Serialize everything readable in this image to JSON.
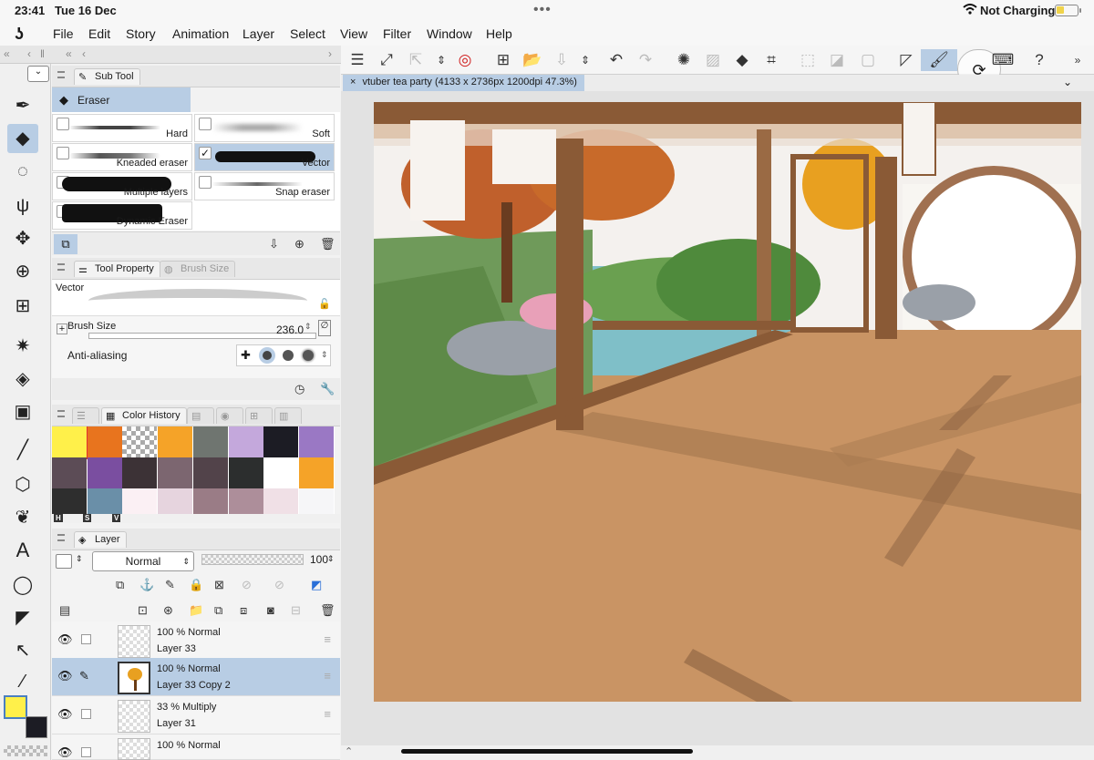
{
  "status": {
    "time": "23:41",
    "date": "Tue 16 Dec",
    "charging": "Not Charging"
  },
  "menu": [
    "File",
    "Edit",
    "Story",
    "Animation",
    "Layer",
    "Select",
    "View",
    "Filter",
    "Window",
    "Help"
  ],
  "subtool": {
    "tab": "Sub Tool",
    "group": "Eraser",
    "brushes": [
      {
        "label": "Hard"
      },
      {
        "label": "Soft"
      },
      {
        "label": "Kneaded eraser"
      },
      {
        "label": "Vector"
      },
      {
        "label": "Multiple layers"
      },
      {
        "label": "Snap eraser"
      },
      {
        "label": "Dynamic Eraser"
      }
    ]
  },
  "tool_property": {
    "tab": "Tool Property",
    "tab2": "Brush Size",
    "preset": "Vector",
    "brush_size_label": "Brush Size",
    "brush_size_value": "236.0",
    "anti_alias_label": "Anti-aliasing"
  },
  "color_history": {
    "tab": "Color History",
    "hsv": [
      "H",
      "S",
      "V"
    ],
    "colors": [
      "#fff04a",
      "#e8741e",
      "checker",
      "#f5a328",
      "#6f7570",
      "#c4a8dc",
      "#1c1c24",
      "#9a78c4",
      "#5c4c56",
      "#7a4ea0",
      "#3c3236",
      "#7c6670",
      "#52434a",
      "#2c2e2e",
      "#ffffff",
      "#f5a328",
      "#2e2e2e",
      "#6a8fa8",
      "#fbf0f4",
      "#e6d4de",
      "#9a7c86",
      "#ad8e9a",
      "#f0e0e6",
      "#f6f6f8"
    ]
  },
  "layer": {
    "tab": "Layer",
    "blend_mode": "Normal",
    "opacity": "100",
    "rows": [
      {
        "mode": "100 %  Normal",
        "name": "Layer 33"
      },
      {
        "mode": "100 %  Normal",
        "name": "Layer 33 Copy 2"
      },
      {
        "mode": "33 %  Multiply",
        "name": "Layer 31"
      },
      {
        "mode": "100 %  Normal",
        "name": ""
      }
    ]
  },
  "canvas": {
    "doc_title": "vtuber tea party (4133 x 2736px 1200dpi 47.3%)"
  },
  "colors": {
    "accent": "#b8cde4",
    "main_color": "#fff04a",
    "sub_color": "#1c1c24"
  }
}
